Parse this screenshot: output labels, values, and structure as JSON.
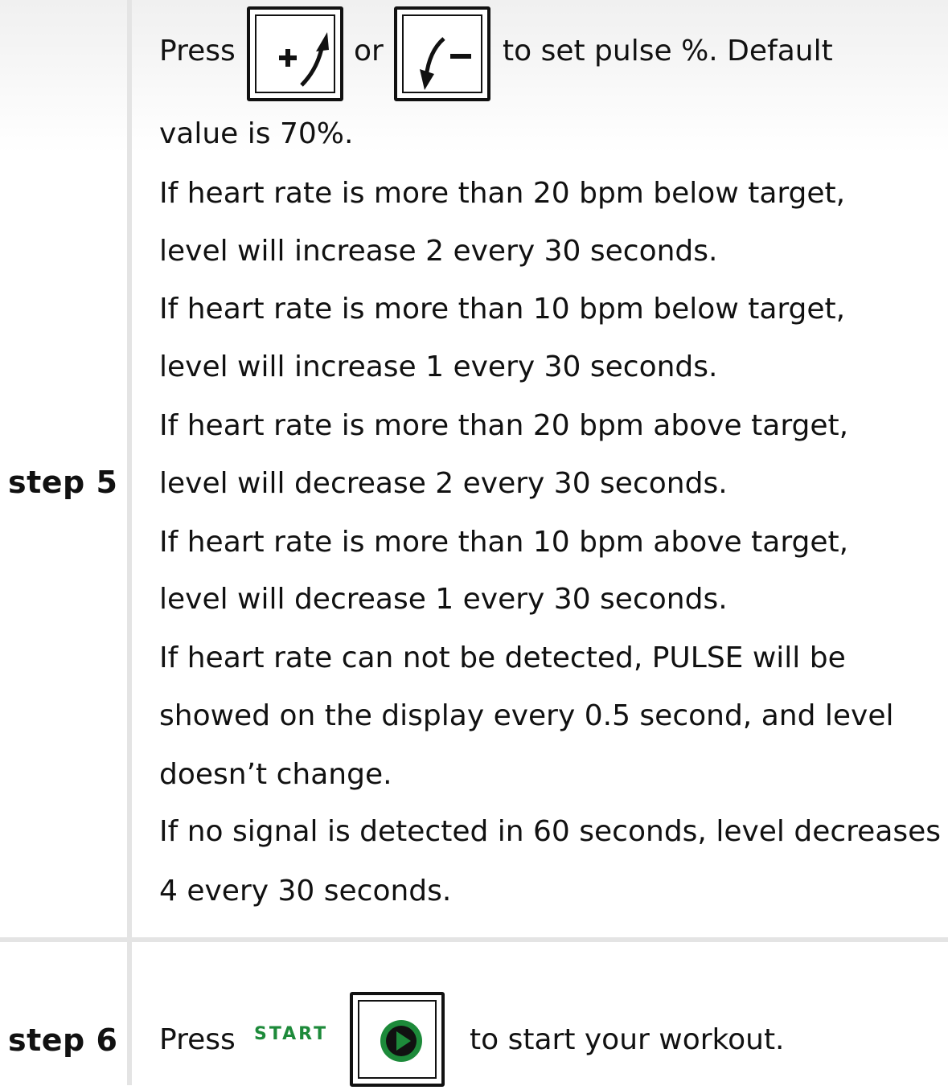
{
  "step5": {
    "label": "step 5",
    "press": "Press",
    "or": "or",
    "suffix": "to set pulse %. Default",
    "lines": [
      "value is 70%.",
      "If heart rate is more than 20 bpm below target,",
      "level will increase 2 every 30 seconds.",
      "If heart rate is more than 10 bpm below target,",
      "level will increase 1 every 30 seconds.",
      "If heart rate is more than 20 bpm above target,",
      "level will decrease 2 every 30 seconds.",
      "If heart rate is more than 10 bpm above target,",
      "level will decrease 1 every 30 seconds.",
      "If heart rate can not be detected, PULSE will be",
      "showed on the display every 0.5 second, and level",
      "doesn’t change.",
      "If no signal is detected in 60 seconds, level decreases",
      "4 every 30 seconds."
    ],
    "icons": [
      "plus-up-arrow-icon",
      "minus-down-arrow-icon"
    ]
  },
  "step6": {
    "label": "step 6",
    "press": "Press",
    "start_word": "START",
    "suffix": "to start your workout.",
    "icon": "play-icon",
    "accent_color": "#1d8a3a"
  }
}
